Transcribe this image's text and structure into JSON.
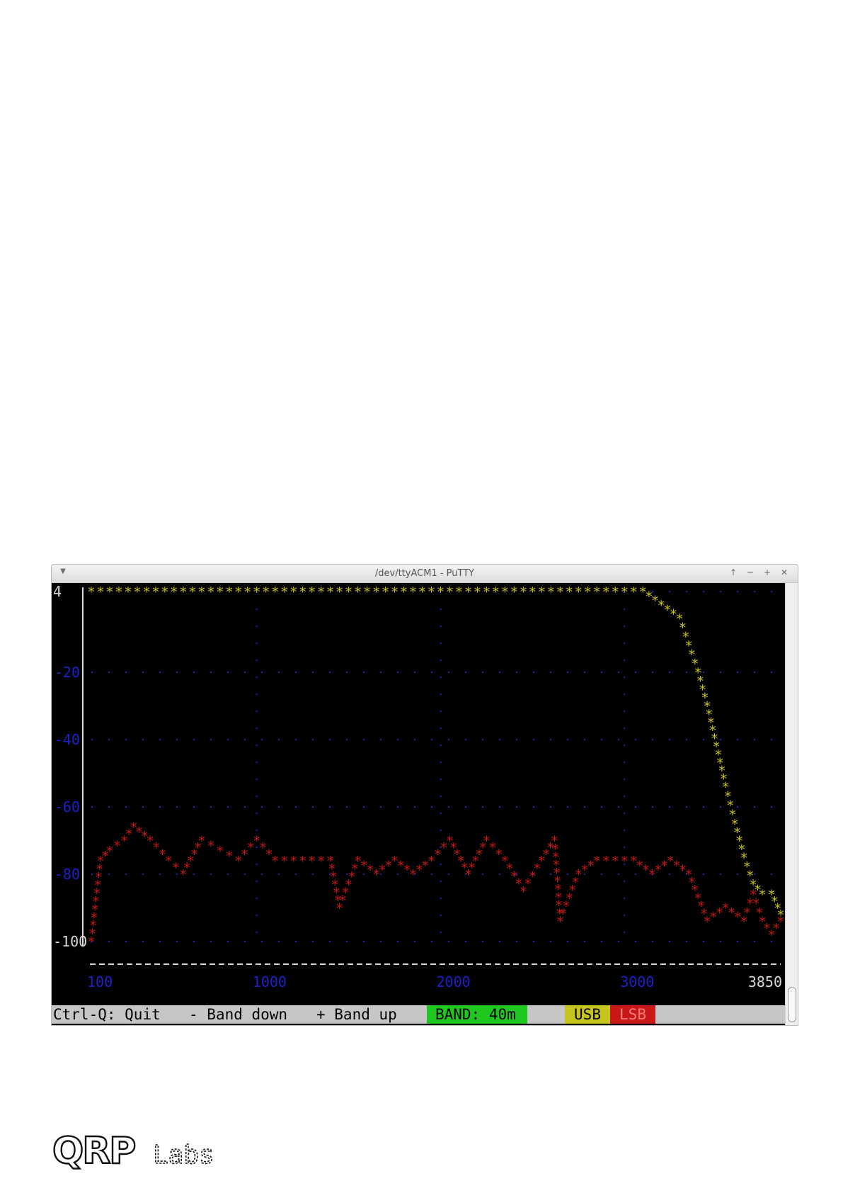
{
  "window": {
    "title": "/dev/ttyACM1 - PuTTY",
    "menu_icon": "chevron-down-icon",
    "controls": [
      {
        "name": "scroll-up-icon",
        "glyph": "↑"
      },
      {
        "name": "minimize-icon",
        "glyph": "−"
      },
      {
        "name": "maximize-icon",
        "glyph": "+"
      },
      {
        "name": "close-icon",
        "glyph": "✕"
      }
    ]
  },
  "colors": {
    "yellow": "#c8c41e",
    "red": "#c81818",
    "blue": "#1a22c8",
    "white": "#d8d8d8",
    "band_bg": "#1ec81e",
    "usb_bg": "#c8c41e",
    "lsb_bg": "#c81818"
  },
  "chart_data": {
    "type": "line",
    "x_tick_labels": [
      "100",
      "1000",
      "2000",
      "3000",
      "3850"
    ],
    "y_tick_labels": [
      "4",
      "-20",
      "-40",
      "-60",
      "-80",
      "-100"
    ],
    "xlim": [
      100,
      3850
    ],
    "ylim": [
      -100,
      4
    ],
    "grid": true,
    "series": [
      {
        "name": "USB",
        "color": "#c8c41e",
        "x": [
          100,
          200,
          400,
          600,
          800,
          1000,
          1200,
          1400,
          1600,
          1800,
          2000,
          2200,
          2400,
          2600,
          2800,
          3000,
          3100,
          3200,
          3300,
          3350,
          3400,
          3450,
          3500,
          3550,
          3600,
          3650,
          3700,
          3750,
          3800,
          3850
        ],
        "y": [
          4,
          4,
          4,
          4,
          4,
          4,
          4,
          4,
          4,
          4,
          4,
          4,
          4,
          4,
          4,
          4,
          4,
          0,
          -4,
          -12,
          -20,
          -30,
          -42,
          -54,
          -65,
          -75,
          -83,
          -86,
          -86,
          -92
        ]
      },
      {
        "name": "LSB",
        "color": "#c81818",
        "x": [
          100,
          150,
          200,
          280,
          330,
          420,
          520,
          600,
          700,
          800,
          900,
          1000,
          1100,
          1200,
          1300,
          1400,
          1450,
          1550,
          1650,
          1750,
          1850,
          1950,
          2050,
          2150,
          2250,
          2350,
          2450,
          2550,
          2620,
          2650,
          2750,
          2850,
          2950,
          3050,
          3150,
          3250,
          3350,
          3450,
          3550,
          3650,
          3700,
          3750,
          3800,
          3850
        ],
        "y": [
          -100,
          -76,
          -73,
          -70,
          -66,
          -70,
          -76,
          -80,
          -70,
          -73,
          -76,
          -70,
          -76,
          -76,
          -76,
          -76,
          -90,
          -76,
          -80,
          -76,
          -80,
          -76,
          -70,
          -80,
          -70,
          -76,
          -85,
          -76,
          -70,
          -94,
          -80,
          -76,
          -76,
          -76,
          -80,
          -76,
          -80,
          -94,
          -90,
          -94,
          -86,
          -94,
          -98,
          -94
        ]
      }
    ]
  },
  "statusbar": {
    "quit": "Ctrl-Q: Quit",
    "band_down": "- Band down",
    "band_up": "+ Band up",
    "band": "BAND: 40m",
    "usb": "USB",
    "lsb": "LSB"
  },
  "logo": {
    "brand": "QRP",
    "sub": "Labs"
  }
}
